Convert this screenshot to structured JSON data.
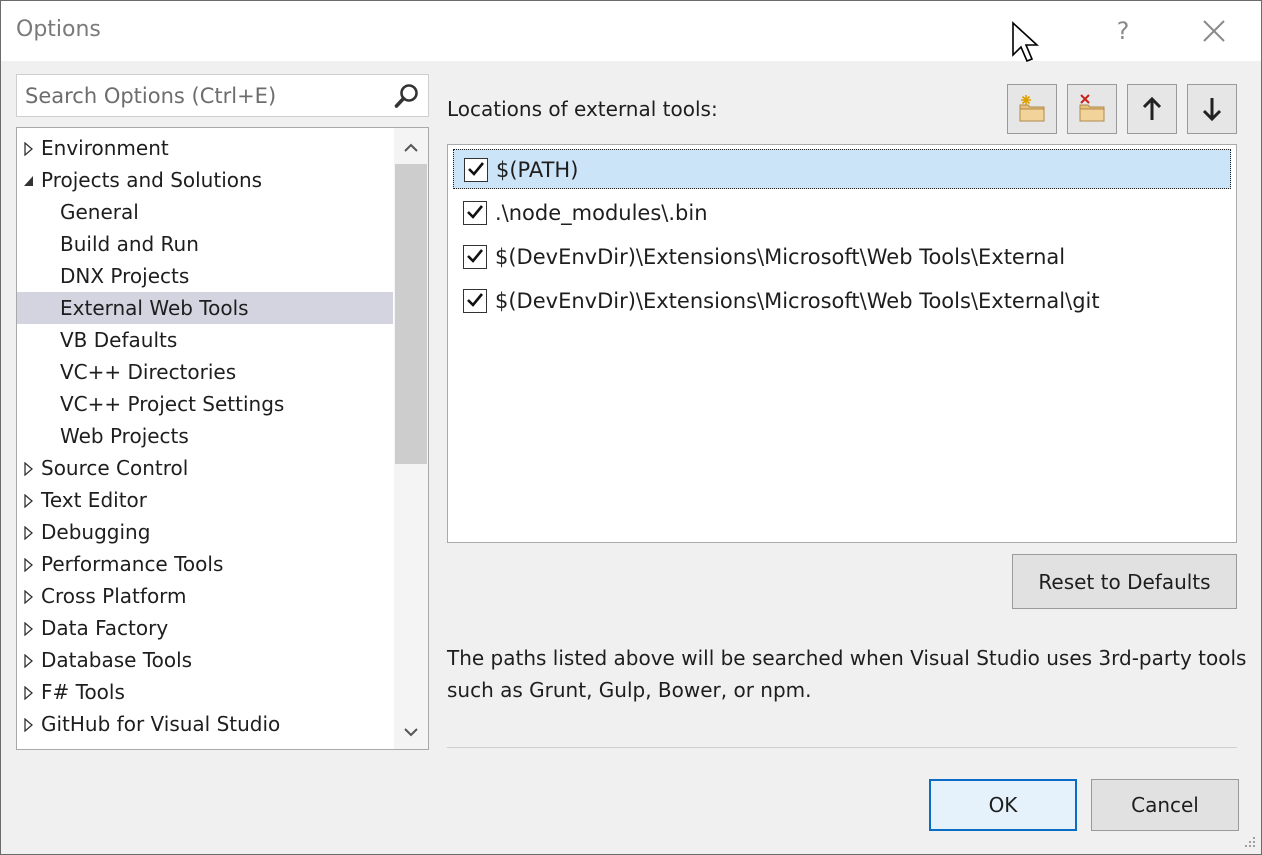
{
  "window": {
    "title": "Options",
    "help_label": "?"
  },
  "search": {
    "placeholder": "Search Options (Ctrl+E)"
  },
  "tree": {
    "items": [
      {
        "label": "Environment",
        "level": 0,
        "expanded": false
      },
      {
        "label": "Projects and Solutions",
        "level": 0,
        "expanded": true
      },
      {
        "label": "General",
        "level": 1
      },
      {
        "label": "Build and Run",
        "level": 1
      },
      {
        "label": "DNX Projects",
        "level": 1
      },
      {
        "label": "External Web Tools",
        "level": 1,
        "selected": true
      },
      {
        "label": "VB Defaults",
        "level": 1
      },
      {
        "label": "VC++ Directories",
        "level": 1
      },
      {
        "label": "VC++ Project Settings",
        "level": 1
      },
      {
        "label": "Web Projects",
        "level": 1
      },
      {
        "label": "Source Control",
        "level": 0,
        "expanded": false
      },
      {
        "label": "Text Editor",
        "level": 0,
        "expanded": false
      },
      {
        "label": "Debugging",
        "level": 0,
        "expanded": false
      },
      {
        "label": "Performance Tools",
        "level": 0,
        "expanded": false
      },
      {
        "label": "Cross Platform",
        "level": 0,
        "expanded": false
      },
      {
        "label": "Data Factory",
        "level": 0,
        "expanded": false
      },
      {
        "label": "Database Tools",
        "level": 0,
        "expanded": false
      },
      {
        "label": "F# Tools",
        "level": 0,
        "expanded": false
      },
      {
        "label": "GitHub for Visual Studio",
        "level": 0,
        "expanded": false
      }
    ]
  },
  "panel": {
    "section_label": "Locations of external tools:",
    "toolbar": {
      "icons": [
        "new-folder-icon",
        "delete-folder-icon",
        "move-up-icon",
        "move-down-icon"
      ]
    },
    "paths": [
      {
        "text": "$(PATH)",
        "checked": true,
        "selected": true
      },
      {
        "text": ".\\node_modules\\.bin",
        "checked": true
      },
      {
        "text": "$(DevEnvDir)\\Extensions\\Microsoft\\Web Tools\\External",
        "checked": true
      },
      {
        "text": "$(DevEnvDir)\\Extensions\\Microsoft\\Web Tools\\External\\git",
        "checked": true
      }
    ],
    "reset_label": "Reset to Defaults",
    "description": "The paths listed above will be searched when Visual Studio uses 3rd-party tools such as Grunt, Gulp, Bower, or npm."
  },
  "footer": {
    "ok_label": "OK",
    "cancel_label": "Cancel"
  },
  "colors": {
    "selection_tree": "#d4d4e0",
    "selection_list": "#cce4f7",
    "default_button_border": "#0a6cc4"
  }
}
